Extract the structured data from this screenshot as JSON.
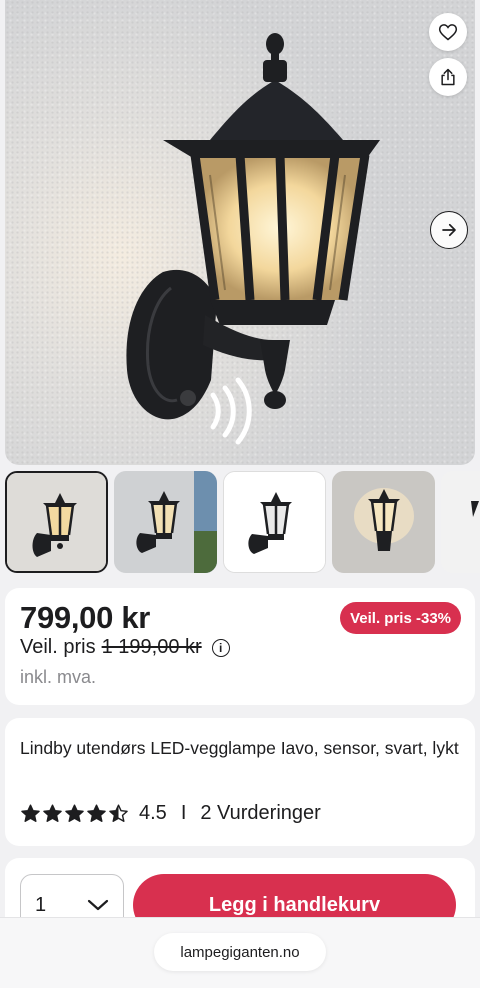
{
  "product": {
    "price": "799,00 kr",
    "discount_badge": "Veil. pris -33%",
    "ref_label": "Veil. pris",
    "ref_price": "1 199,00 kr",
    "info_icon": "i",
    "vat_note": "inkl. mva.",
    "title": "Lindby utendørs LED-vegglampe Iavo, sensor, svart, lykt",
    "rating_value": "4.5",
    "rating_separator": "I",
    "rating_count": "2 Vurderinger",
    "stars_filled": 4.5,
    "stars_total": 5
  },
  "purchase": {
    "quantity": "1",
    "add_to_cart": "Legg i handlekurv"
  },
  "browser": {
    "url": "lampegiganten.no"
  },
  "icons": {
    "favorite": "heart-icon",
    "share": "share-icon",
    "next": "arrow-right-icon",
    "dropdown": "chevron-down-icon"
  },
  "colors": {
    "accent": "#d8304f",
    "text": "#1d1d1f",
    "muted": "#8a8a8e",
    "background": "#f1f1f3"
  }
}
